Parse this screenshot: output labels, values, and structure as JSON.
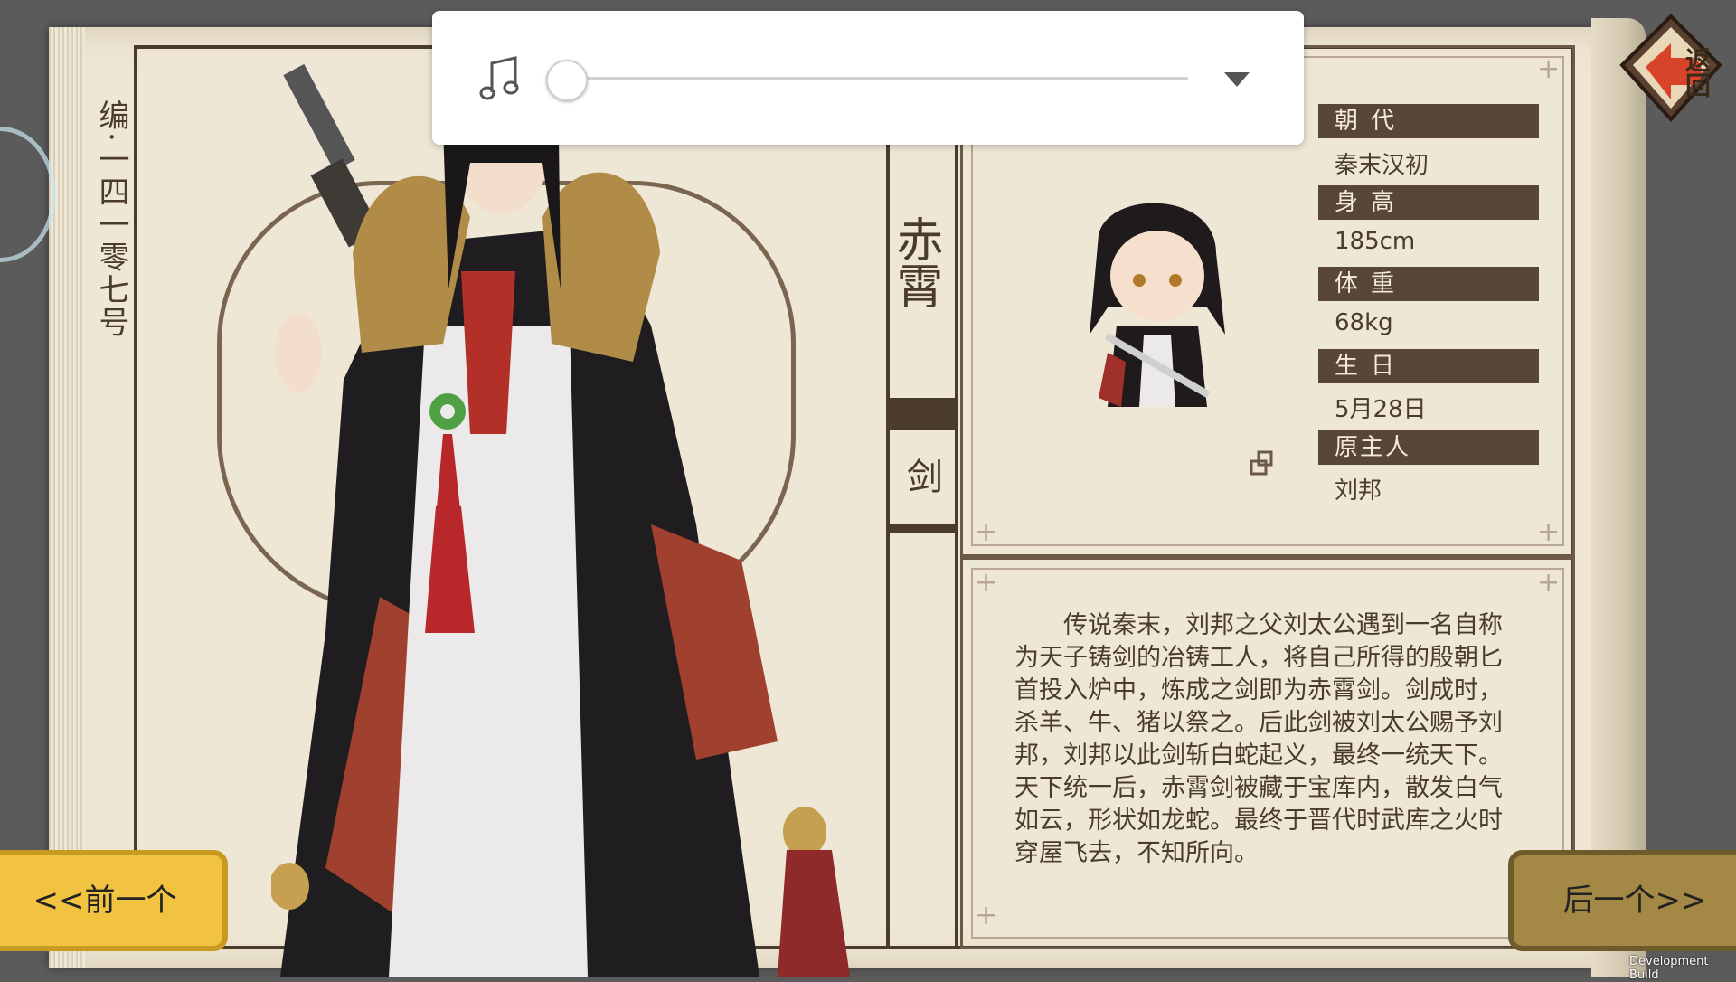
{
  "audio": {
    "icon": "music-note-icon",
    "volume": 0.0,
    "dropdown_icon": "caret-down-icon"
  },
  "back_button": {
    "label": "返回",
    "icon": "back-arrow-icon"
  },
  "serial_number": "编·一四一零七号",
  "character": {
    "name": "赤霄",
    "type": "剑"
  },
  "profile": {
    "fields": [
      {
        "label": "朝代",
        "value": "秦末汉初"
      },
      {
        "label": "身高",
        "value": "185cm"
      },
      {
        "label": "体重",
        "value": "68kg"
      },
      {
        "label": "生日",
        "value": "5月28日"
      },
      {
        "label": "原主人",
        "value": "刘邦"
      }
    ]
  },
  "description": "传说秦末，刘邦之父刘太公遇到一名自称为天子铸剑的冶铸工人，将自己所得的殷朝匕首投入炉中，炼成之剑即为赤霄剑。剑成时，杀羊、牛、猪以祭之。后此剑被刘太公赐予刘邦，刘邦以此剑斩白蛇起义，最终一统天下。天下统一后，赤霄剑被藏于宝库内，散发白气如云，形状如龙蛇。最终于晋代时武库之火时穿屋飞去，不知所向。",
  "nav": {
    "prev_label": "<<前一个",
    "next_label": "后一个>>"
  },
  "footer": {
    "dev_build": "Development Build"
  },
  "colors": {
    "paper": "#efe7d5",
    "ink": "#4a3b2d",
    "label_bg": "#58463a",
    "prev_button": "#f1c341",
    "next_button": "#a48845"
  }
}
